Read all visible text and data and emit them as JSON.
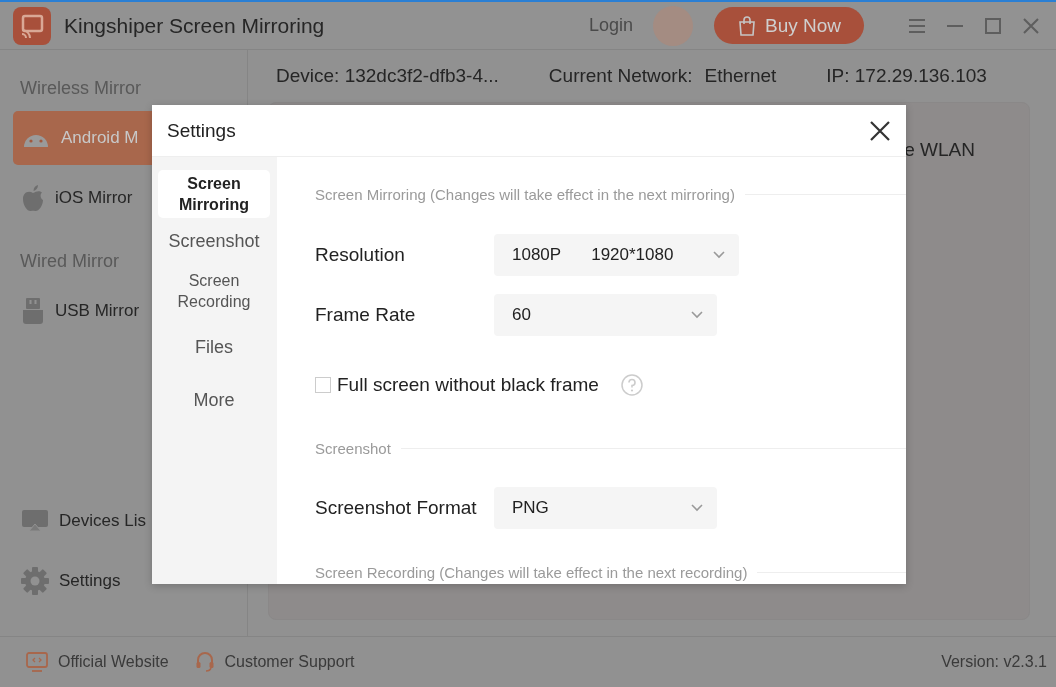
{
  "window": {
    "title": "Kingshiper Screen Mirroring"
  },
  "header": {
    "login": "Login",
    "buy_button": "Buy Now"
  },
  "info_bar": {
    "device": "Device: 132dc3f2-dfb3-4...",
    "network_label": "Current Network:",
    "network": "Ethernet",
    "ip": "IP: 172.29.136.103"
  },
  "sidebar": {
    "sections": [
      {
        "title": "Wireless Mirror",
        "items": [
          {
            "label": "Android M",
            "kind": "android",
            "selected": true
          },
          {
            "label": "iOS Mirror",
            "kind": "apple",
            "selected": false
          }
        ]
      },
      {
        "title": "Wired Mirror",
        "items": [
          {
            "label": "USB Mirror",
            "kind": "usb",
            "selected": false
          }
        ]
      }
    ],
    "bottom_items": [
      {
        "label": "Devices Lis",
        "kind": "devices"
      },
      {
        "label": "Settings",
        "kind": "gear"
      }
    ]
  },
  "content": {
    "partial_text": "e WLAN"
  },
  "footer": {
    "links": [
      {
        "label": "Official Website",
        "kind": "website"
      },
      {
        "label": "Customer Support",
        "kind": "headset"
      }
    ],
    "version": "Version: v2.3.1"
  },
  "dialog": {
    "title": "Settings",
    "nav": [
      {
        "label": "Screen Mirroring",
        "selected": true
      },
      {
        "label": "Screenshot",
        "selected": false
      },
      {
        "label": "Screen Recording",
        "selected": false
      },
      {
        "label": "Files",
        "selected": false
      },
      {
        "label": "More",
        "selected": false
      }
    ],
    "sections": [
      {
        "heading": "Screen Mirroring (Changes will take effect in the next mirroring)",
        "rows": [
          {
            "kind": "select",
            "label": "Resolution",
            "value": "1080P",
            "value_detail": "1920*1080"
          },
          {
            "kind": "select",
            "label": "Frame Rate",
            "value": "60"
          },
          {
            "kind": "checkbox",
            "label": "Full screen without black frame",
            "checked": false,
            "help": true
          }
        ]
      },
      {
        "heading": "Screenshot",
        "rows": [
          {
            "kind": "select",
            "label": "Screenshot Format",
            "value": "PNG"
          }
        ]
      },
      {
        "heading": "Screen Recording (Changes will take effect in the next recording)"
      }
    ]
  }
}
